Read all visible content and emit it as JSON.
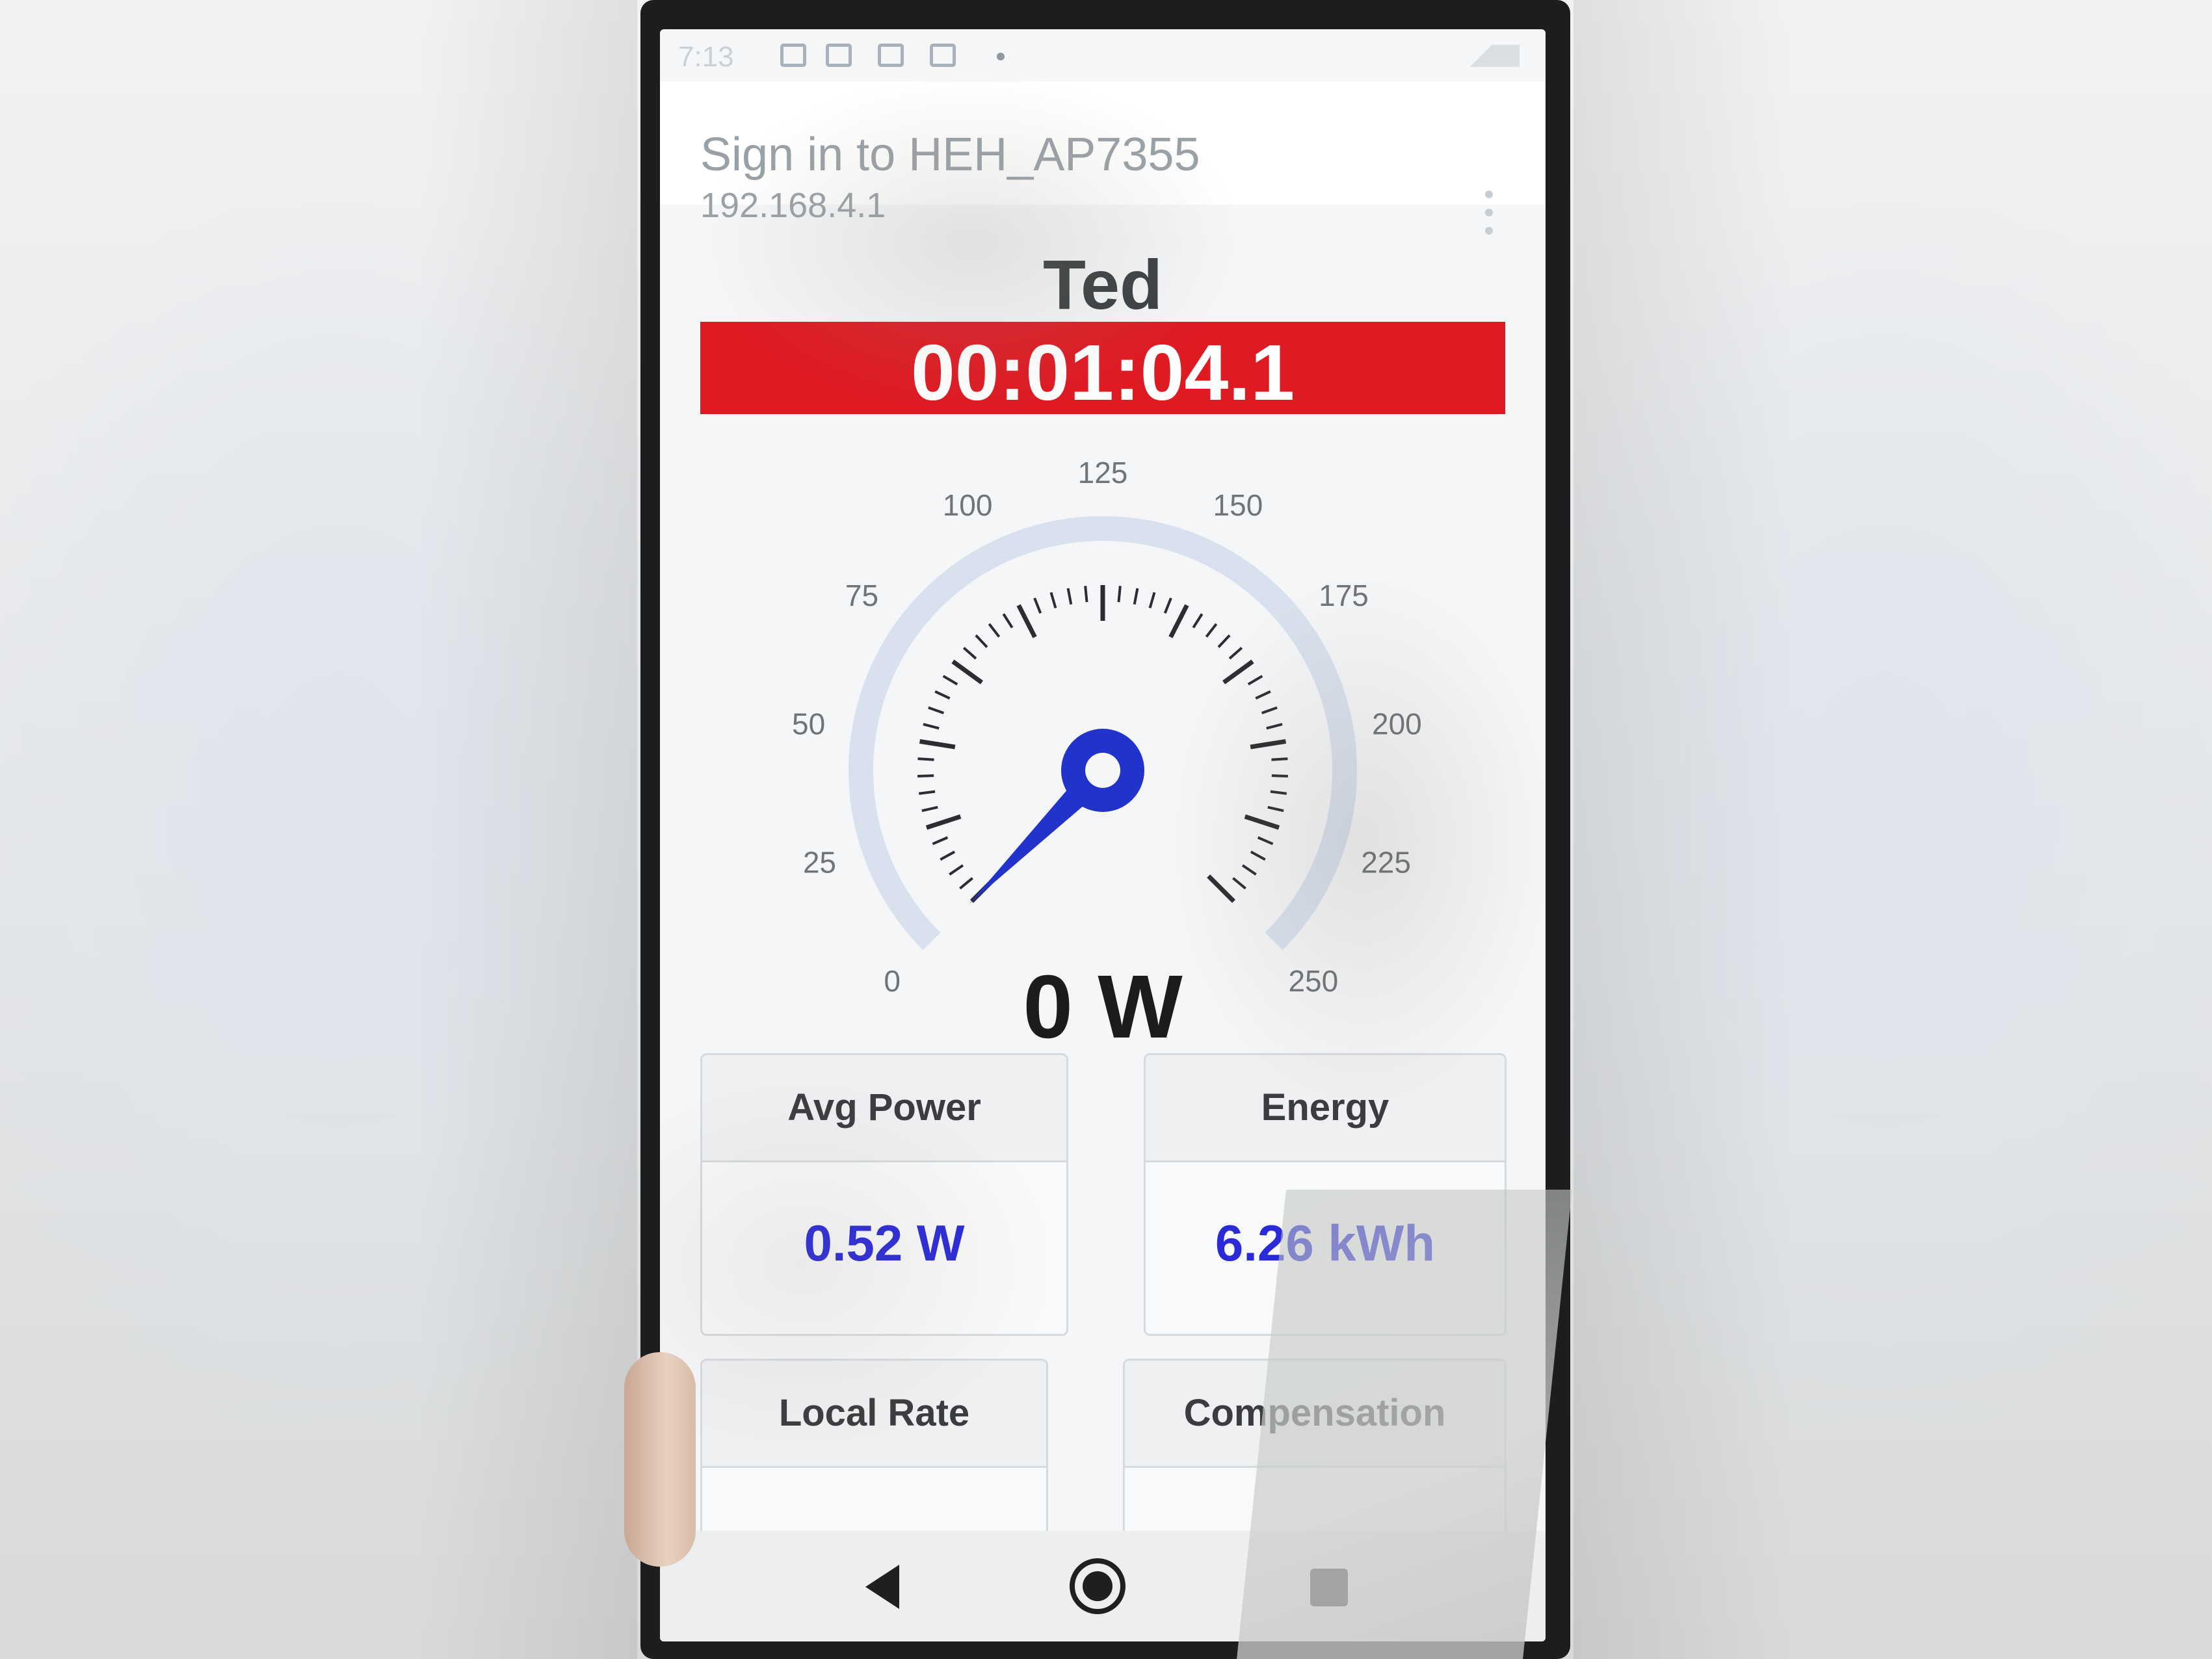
{
  "status_bar": {
    "time": "7:13"
  },
  "portal": {
    "title": "Sign in to HEH_AP7355",
    "url": "192.168.4.1",
    "menu_icon": "more-vert-icon"
  },
  "device": {
    "name": "Ted",
    "timer": "00:01:04.1"
  },
  "gauge": {
    "min": 0,
    "max": 250,
    "major_step": 25,
    "tick_labels": [
      "0",
      "25",
      "50",
      "75",
      "100",
      "125",
      "150",
      "175",
      "200",
      "225",
      "250"
    ],
    "value": 0,
    "accent_color": "#2233cc",
    "track_color": "#d9e1ee"
  },
  "readout": {
    "power": "0 W"
  },
  "cards": [
    {
      "title": "Avg Power",
      "value": "0.52 W"
    },
    {
      "title": "Energy",
      "value": "6.26 kWh"
    },
    {
      "title": "Local Rate",
      "value": ""
    },
    {
      "title": "Compensation",
      "value": ""
    }
  ],
  "nav": {
    "back_icon": "back-triangle-icon",
    "home_icon": "home-circle-icon",
    "recent_icon": "recent-square-icon"
  },
  "colors": {
    "timer_bg": "#de1a23",
    "value_text": "#2a2ad8"
  }
}
